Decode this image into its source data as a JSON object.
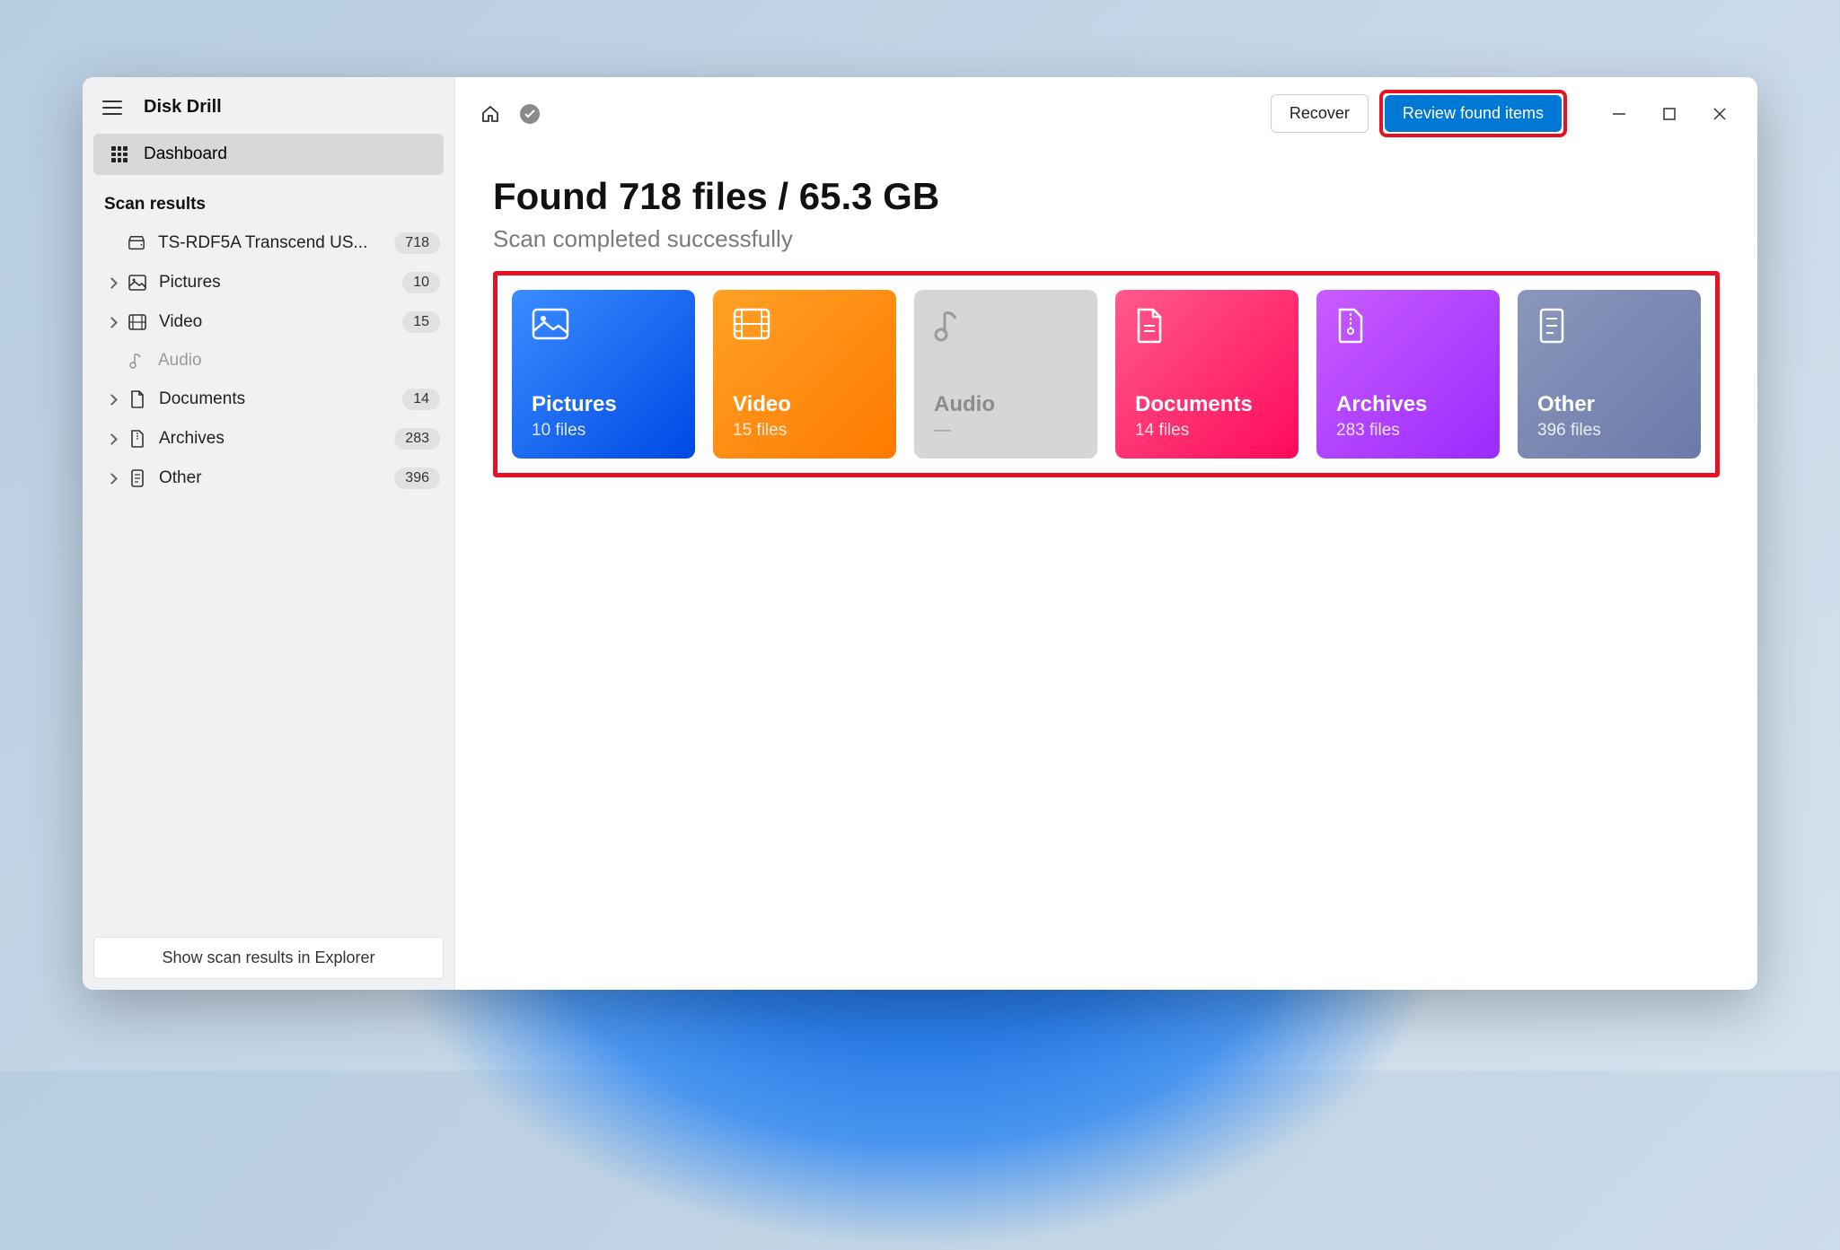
{
  "app": {
    "title": "Disk Drill"
  },
  "sidebar": {
    "dashboard_label": "Dashboard",
    "section_label": "Scan results",
    "device": {
      "label": "TS-RDF5A Transcend US...",
      "count": "718"
    },
    "items": [
      {
        "label": "Pictures",
        "count": "10"
      },
      {
        "label": "Video",
        "count": "15"
      },
      {
        "label": "Audio",
        "count": ""
      },
      {
        "label": "Documents",
        "count": "14"
      },
      {
        "label": "Archives",
        "count": "283"
      },
      {
        "label": "Other",
        "count": "396"
      }
    ],
    "footer_button": "Show scan results in Explorer"
  },
  "toolbar": {
    "recover_label": "Recover",
    "review_label": "Review found items"
  },
  "summary": {
    "headline": "Found 718 files / 65.3 GB",
    "subhead": "Scan completed successfully"
  },
  "cards": [
    {
      "title": "Pictures",
      "count": "10 files"
    },
    {
      "title": "Video",
      "count": "15 files"
    },
    {
      "title": "Audio",
      "count": "—"
    },
    {
      "title": "Documents",
      "count": "14 files"
    },
    {
      "title": "Archives",
      "count": "283 files"
    },
    {
      "title": "Other",
      "count": "396 files"
    }
  ]
}
